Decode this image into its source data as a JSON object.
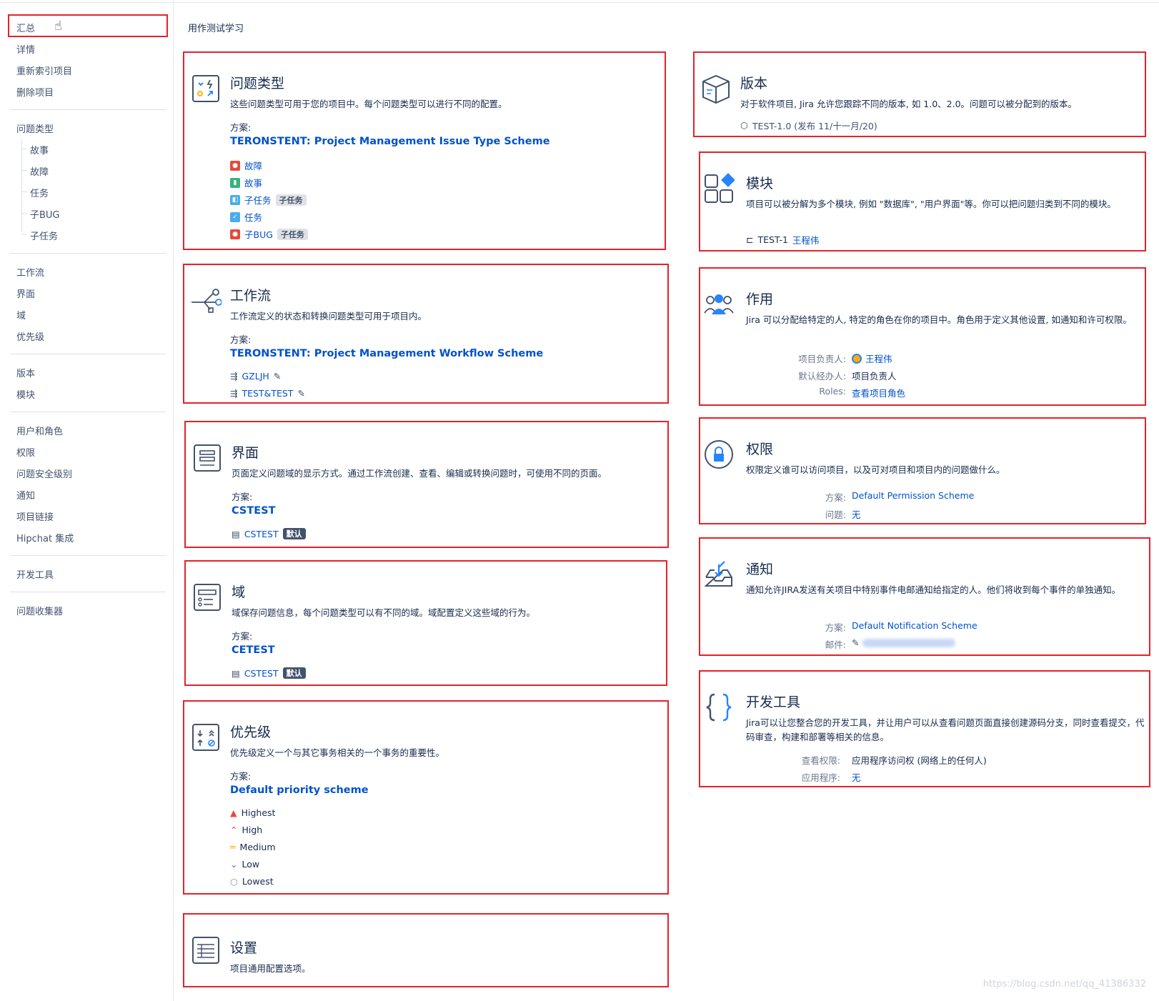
{
  "project_title": "用作测试学习",
  "sidebar": {
    "group1": [
      "汇总",
      "详情",
      "重新索引项目",
      "删除项目"
    ],
    "issue_types_label": "问题类型",
    "issue_types": [
      "故事",
      "故障",
      "任务",
      "子BUG",
      "子任务"
    ],
    "group3": [
      "工作流",
      "界面",
      "域",
      "优先级"
    ],
    "group4": [
      "版本",
      "模块"
    ],
    "group5": [
      "用户和角色",
      "权限",
      "问题安全级别",
      "通知",
      "项目链接",
      "Hipchat 集成"
    ],
    "group6": [
      "开发工具"
    ],
    "group7": [
      "问题收集器"
    ]
  },
  "issue_types_card": {
    "title": "问题类型",
    "desc": "这些问题类型可用于您的项目中。每个问题类型可以进行不同的配置。",
    "scheme_label": "方案:",
    "scheme": "TERONSTENT: Project Management Issue Type Scheme",
    "items": [
      {
        "label": "故障",
        "color": "#e5493a",
        "badge": ""
      },
      {
        "label": "故事",
        "color": "#36b37e",
        "badge": ""
      },
      {
        "label": "子任务",
        "color": "#4bade8",
        "badge": "子任务"
      },
      {
        "label": "任务",
        "color": "#4bade8",
        "badge": ""
      },
      {
        "label": "子BUG",
        "color": "#e5493a",
        "badge": "子任务"
      }
    ]
  },
  "workflow_card": {
    "title": "工作流",
    "desc": "工作流定义的状态和转换问题类型可用于项目内。",
    "scheme_label": "方案:",
    "scheme": "TERONSTENT: Project Management Workflow Scheme",
    "items": [
      "GZLJH",
      "TEST&TEST"
    ]
  },
  "screens_card": {
    "title": "界面",
    "desc": "页面定义问题域的显示方式。通过工作流创建、查看、编辑或转换问题时，可使用不同的页面。",
    "scheme_label": "方案:",
    "scheme": "CSTEST",
    "item": "CSTEST",
    "badge": "默认"
  },
  "fields_card": {
    "title": "域",
    "desc": "域保存问题信息，每个问题类型可以有不同的域。域配置定义这些域的行为。",
    "scheme_label": "方案:",
    "scheme": "CETEST",
    "item": "CSTEST",
    "badge": "默认"
  },
  "priority_card": {
    "title": "优先级",
    "desc": "优先级定义一个与其它事务相关的一个事务的重要性。",
    "scheme_label": "方案:",
    "scheme": "Default priority scheme",
    "items": [
      {
        "label": "Highest",
        "color": "#e5493a"
      },
      {
        "label": "High",
        "color": "#e5493a"
      },
      {
        "label": "Medium",
        "color": "#ffab00"
      },
      {
        "label": "Low",
        "color": "#2684ff"
      },
      {
        "label": "Lowest",
        "color": "#8993a4"
      }
    ]
  },
  "settings_card": {
    "title": "设置",
    "desc": "项目通用配置选项。"
  },
  "versions_card": {
    "title": "版本",
    "desc": "对于软件项目, Jira 允许您跟踪不同的版本, 如 1.0、2.0。问题可以被分配到的版本。",
    "item": "TEST-1.0 (发布 11/十一月/20)"
  },
  "components_card": {
    "title": "模块",
    "desc": "项目可以被分解为多个模块, 例如 \"数据库\", \"用户界面\"等。你可以把问题归类到不同的模块。",
    "item_key": "TEST-1",
    "item_lead": "王程伟"
  },
  "roles_card": {
    "title": "作用",
    "desc": "Jira 可以分配给特定的人, 特定的角色在你的项目中。角色用于定义其他设置, 如通知和许可权限。",
    "lead_label": "项目负责人:",
    "lead": "王程伟",
    "assignee_label": "默认经办人:",
    "assignee": "项目负责人",
    "roles_label": "Roles:",
    "roles_link": "查看项目角色"
  },
  "permissions_card": {
    "title": "权限",
    "desc": "权限定义谁可以访问项目，以及可对项目和项目内的问题做什么。",
    "scheme_label": "方案:",
    "scheme": "Default Permission Scheme",
    "issues_label": "问题:",
    "issues": "无"
  },
  "notifications_card": {
    "title": "通知",
    "desc": "通知允许JIRA发送有关项目中特别事件电邮通知给指定的人。他们将收到每个事件的单独通知。",
    "scheme_label": "方案:",
    "scheme": "Default Notification Scheme",
    "email_label": "邮件:"
  },
  "devtools_card": {
    "title": "开发工具",
    "desc": "Jira可以让您整合您的开发工具，并让用户可以从查看问题页面直接创建源码分支，同时查看提交，代码审查，构建和部署等相关的信息。",
    "perm_label": "查看权限:",
    "perm": "应用程序访问权 (网络上的任何人)",
    "apps_label": "应用程序:",
    "apps": "无"
  },
  "watermark": "https://blog.csdn.net/qq_41386332",
  "colors": {
    "highlight": "#e5222a",
    "link": "#0052cc",
    "text": "#172b4d"
  }
}
